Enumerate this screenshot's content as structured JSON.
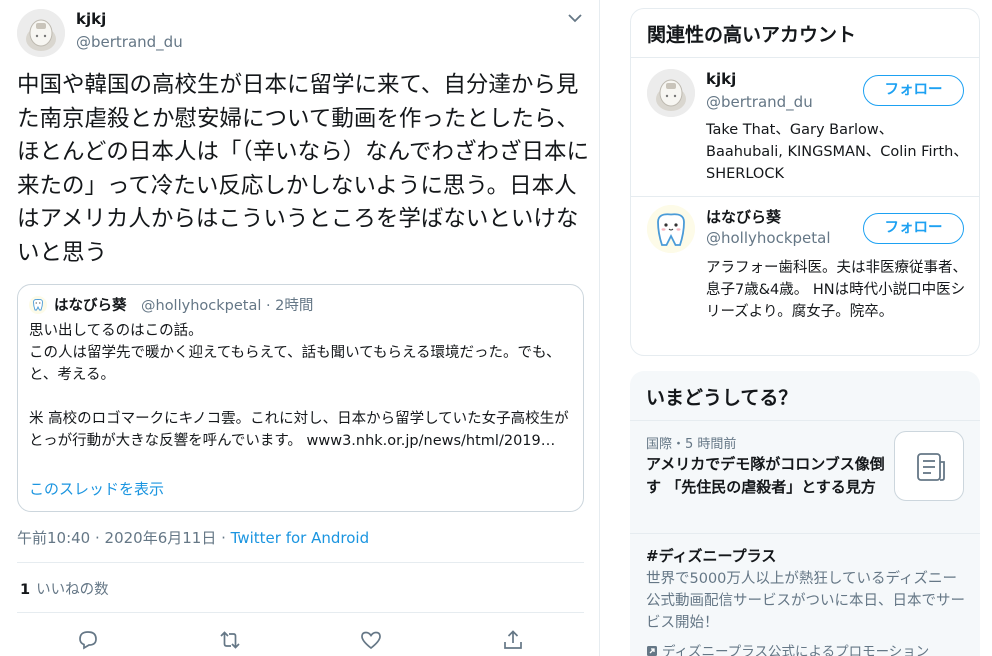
{
  "tweet": {
    "author_name": "kjkj",
    "author_handle": "@bertrand_du",
    "text": "中国や韓国の高校生が日本に留学に来て、自分達から見た南京虐殺とか慰安婦について動画を作ったとしたら、ほとんどの日本人は「（辛いなら）なんでわざわざ日本に来たの」って冷たい反応しかしないように思う。日本人はアメリカ人からはこういうところを学ばないといけないと思う",
    "quote": {
      "author_name": "はなびら葵",
      "meta": "@hollyhockpetal · 2時間",
      "text": "思い出してるのはこの話。\nこの人は留学先で暖かく迎えてもらえて、話も聞いてもらえる環境だった。でも、と、考える。\n\n米 高校のロゴマークにキノコ雲。これに対し、日本から留学していた女子高校生がとっが行動が大きな反響を呼んでいます。 www3.nhk.or.jp/news/html/2019…",
      "show_thread": "このスレッドを表示"
    },
    "timestamp": "午前10:40 · 2020年6月11日 · ",
    "client": "Twitter for Android",
    "likes_count": "1",
    "likes_label": "いいねの数"
  },
  "related": {
    "title": "関連性の高いアカウント",
    "follow_label": "フォロー",
    "accounts": [
      {
        "name": "kjkj",
        "handle": "@bertrand_du",
        "bio": "Take That、Gary Barlow、Baahubali, KINGSMAN、Colin Firth、SHERLOCK"
      },
      {
        "name": "はなびら葵",
        "handle": "@hollyhockpetal",
        "bio": "アラフォー歯科医。夫は非医療従事者、息子7歳&4歳。 HNは時代小説口中医シリーズより。腐女子。院卒。"
      }
    ]
  },
  "trends": {
    "title": "いまどうしてる？",
    "items": [
      {
        "meta": "国際・5 時間前",
        "title": "アメリカでデモ隊がコロンブス像倒す 「先住民の虐殺者」とする見方"
      },
      {
        "title": "#ディズニープラス",
        "desc": "世界で5000万人以上が熱狂しているディズニー公式動画配信サービスがついに本日、日本でサービス開始！",
        "promo": "ディズニープラス公式によるプロモーション"
      }
    ]
  },
  "colors": {
    "accent": "#1da1f2",
    "link": "#1b95e0",
    "secondary_text": "#657786",
    "border": "#e6ecf0"
  },
  "icons": [
    "chevron-down-icon",
    "reply-icon",
    "retweet-icon",
    "like-icon",
    "share-icon",
    "article-icon",
    "promoted-icon"
  ]
}
